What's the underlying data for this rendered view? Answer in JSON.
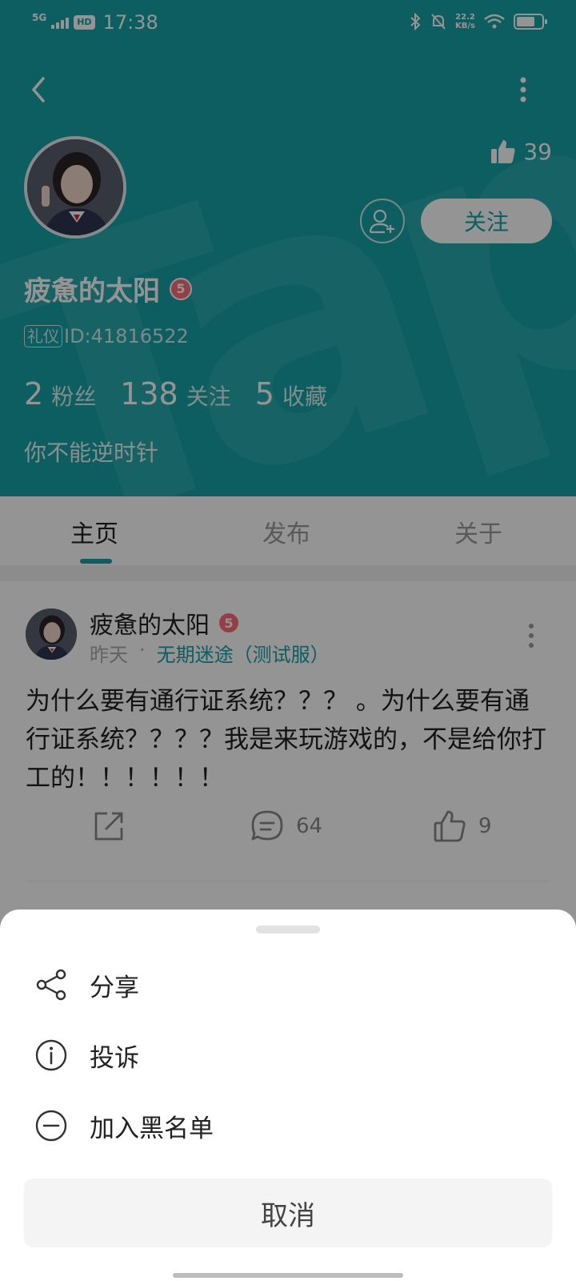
{
  "status_bar": {
    "network": "5G",
    "hd": "HD",
    "time": "17:38",
    "speed_value": "22.2",
    "speed_unit": "KB/s"
  },
  "profile": {
    "likes": "39",
    "follow_label": "关注",
    "name": "疲惫的太阳",
    "level": "5",
    "tag": "礼仪",
    "id_text": "ID:41816522",
    "stats": [
      {
        "num": "2",
        "label": "粉丝"
      },
      {
        "num": "138",
        "label": "关注"
      },
      {
        "num": "5",
        "label": "收藏"
      }
    ],
    "bio": "你不能逆时针",
    "theme_color": "#17a3a7"
  },
  "tabs": [
    "主页",
    "发布",
    "关于"
  ],
  "post": {
    "author": "疲惫的太阳",
    "level": "5",
    "time": "昨天",
    "separator": "·",
    "game": "无期迷途（测试服）",
    "text": "为什么要有通行证系统？？？ 。为什么要有通行证系统？？？？我是来玩游戏的，不是给你打工的！！！！！！",
    "comments": "64",
    "likes": "9"
  },
  "sheet": {
    "items": [
      {
        "icon": "share-icon",
        "label": "分享"
      },
      {
        "icon": "info-icon",
        "label": "投诉"
      },
      {
        "icon": "minus-circle-icon",
        "label": "加入黑名单"
      }
    ],
    "cancel_label": "取消"
  }
}
